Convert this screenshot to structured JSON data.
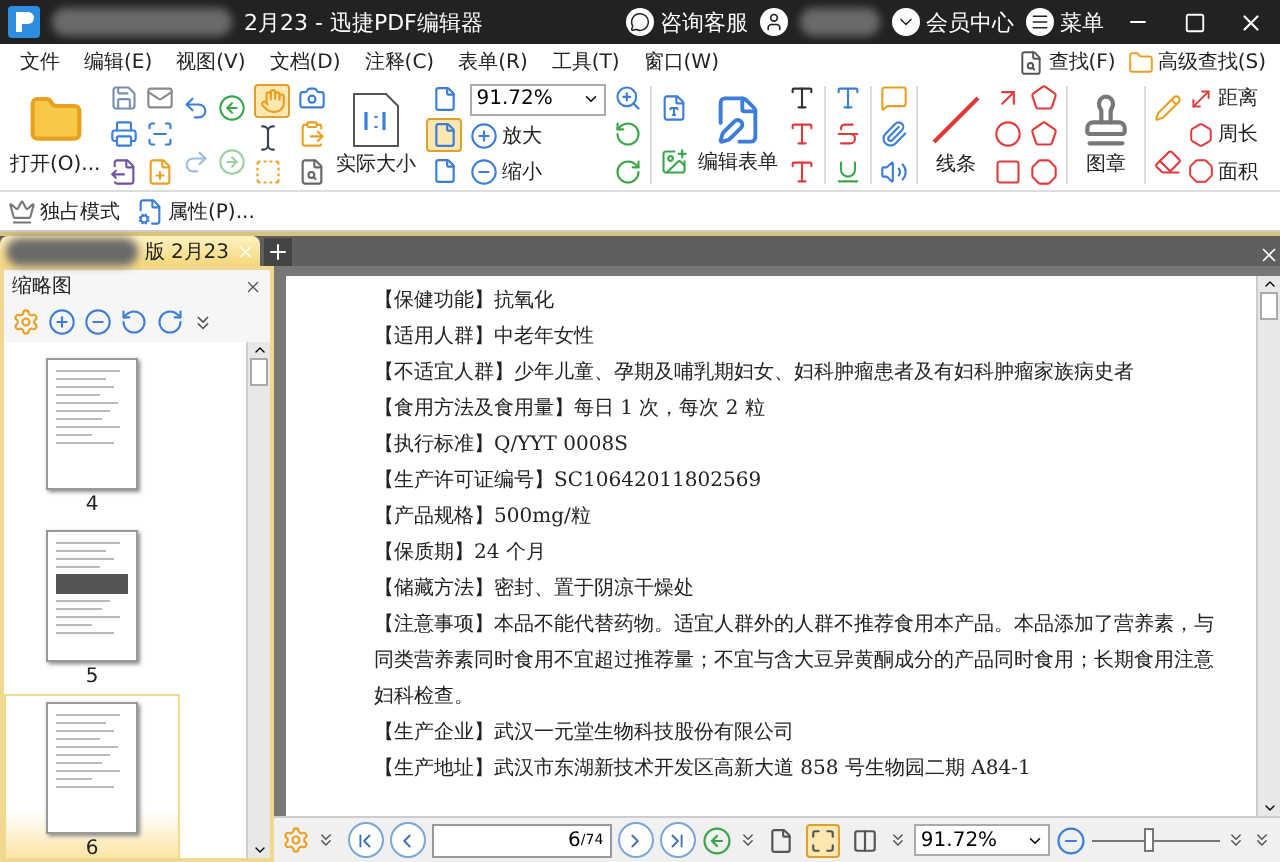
{
  "window": {
    "title": "2月23 - 迅捷PDF编辑器"
  },
  "title_actions": [
    "咨询客服",
    "会员中心",
    "菜单"
  ],
  "menu": [
    "文件",
    "编辑(E)",
    "视图(V)",
    "文档(D)",
    "注释(C)",
    "表单(R)",
    "工具(T)",
    "窗口(W)"
  ],
  "find_buttons": [
    "查找(F)",
    "高级查找(S)"
  ],
  "toolbar": {
    "open": "打开(O)...",
    "actual_size": "实际大小",
    "zoom": "91.72%",
    "zoom_in": "放大",
    "zoom_out": "缩小",
    "edit_form": "编辑表单",
    "line": "线条",
    "stamp": "图章",
    "measure": [
      "距离",
      "周长",
      "面积"
    ],
    "hand_tool": {
      "selected": true
    },
    "fit_modes": [
      {
        "selected": false
      },
      {
        "selected": true
      },
      {
        "selected": false
      }
    ]
  },
  "ribbon2": [
    "独占模式",
    "属性(P)..."
  ],
  "tabs": [
    {
      "label": "版 2月23",
      "selected": true
    }
  ],
  "thumbnails": {
    "title": "缩略图",
    "pages": [
      {
        "label": "4",
        "selected": false
      },
      {
        "label": "5",
        "selected": false
      },
      {
        "label": "6",
        "selected": true
      }
    ]
  },
  "document": {
    "lines": [
      "【保健功能】抗氧化",
      "【适用人群】中老年女性",
      "【不适宜人群】少年儿童、孕期及哺乳期妇女、妇科肿瘤患者及有妇科肿瘤家族病史者",
      "【食用方法及食用量】每日 1 次，每次 2 粒",
      "【执行标准】Q/YYT 0008S",
      "【生产许可证编号】SC10642011802569",
      "【产品规格】500mg/粒",
      "【保质期】24 个月",
      "【储藏方法】密封、置于阴凉干燥处",
      "【注意事项】本品不能代替药物。适宜人群外的人群不推荐食用本产品。本品添加了营养素，与同类营养素同时食用不宜超过推荐量；不宜与含大豆异黄酮成分的产品同时食用；长期食用注意妇科检查。",
      "【生产企业】武汉一元堂生物科技股份有限公司",
      "【生产地址】武汉市东湖新技术开发区高新大道 858 号生物园二期 A84-1"
    ]
  },
  "status": {
    "page": "6",
    "total": "/74",
    "zoom": "91.72%",
    "zoom_slider": {
      "level": 0.45
    },
    "layouts": [
      {
        "selected": false
      },
      {
        "selected": true
      },
      {
        "selected": false
      }
    ]
  }
}
